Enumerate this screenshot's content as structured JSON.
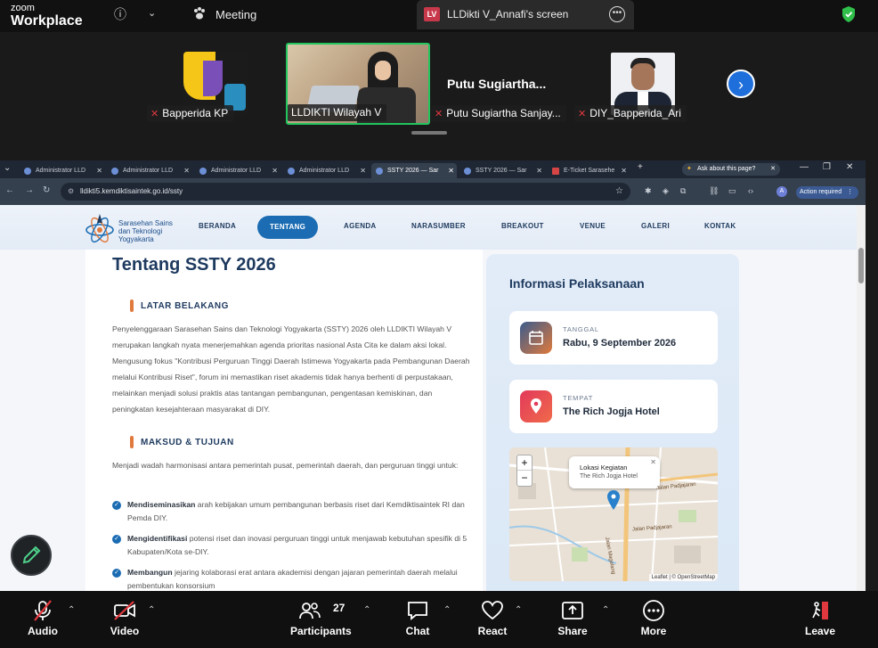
{
  "zoom": {
    "brand_small": "zoom",
    "brand_big": "Workplace",
    "meeting_label": "Meeting",
    "share_badge": "LV",
    "share_label": "LLDikti V_Annafi's screen"
  },
  "participants": [
    {
      "name": "Bapperida KP"
    },
    {
      "name": "LLDIKTI Wilayah V"
    },
    {
      "name": "Putu Sugiartha Sanjay...",
      "title": "Putu  Sugiartha..."
    },
    {
      "name": "DIY_Bapperida_Ari"
    }
  ],
  "browser": {
    "tabs": [
      {
        "label": "Administrator LLD"
      },
      {
        "label": "Administrator LLD"
      },
      {
        "label": "Administrator LLD"
      },
      {
        "label": "Administrator LLD"
      },
      {
        "label": "SSTY 2026 — Sar"
      },
      {
        "label": "SSTY 2026 — Sar"
      },
      {
        "label": "E-Ticket Sarasehe"
      }
    ],
    "ask_label": "Ask about this page?",
    "url": "lldikti5.kemdiktisaintek.go.id/ssty",
    "action_required": "Action required"
  },
  "site": {
    "brand_line1": "Sarasehan Sains",
    "brand_line2": "dan Teknologi",
    "brand_line3": "Yogyakarta",
    "nav": [
      "BERANDA",
      "TENTANG",
      "AGENDA",
      "NARASUMBER",
      "BREAKOUT",
      "VENUE",
      "GALERI",
      "KONTAK"
    ],
    "page_title": "Tentang SSTY 2026",
    "section1_head": "LATAR BELAKANG",
    "section1_text": "Penyelenggaraan Sarasehan Sains dan Teknologi Yogyakarta (SSTY) 2026 oleh LLDIKTI Wilayah V merupakan langkah nyata menerjemahkan agenda prioritas nasional Asta Cita ke dalam aksi lokal. Mengusung fokus \"Kontribusi Perguruan Tinggi Daerah Istimewa Yogyakarta pada Pembangunan Daerah melalui Kontribusi Riset\", forum ini memastikan riset akademis tidak hanya berhenti di perpustakaan, melainkan menjadi solusi praktis atas tantangan pembangunan, pengentasan kemiskinan, dan peningkatan kesejahteraan masyarakat di DIY.",
    "section2_head": "MAKSUD & TUJUAN",
    "section2_intro": "Menjadi wadah harmonisasi antara pemerintah pusat, pemerintah daerah, dan perguruan tinggi untuk:",
    "bullets": [
      {
        "bold": "Mendiseminasikan",
        "text": " arah kebijakan umum pembangunan berbasis riset dari Kemdiktisaintek RI dan Pemda DIY."
      },
      {
        "bold": "Mengidentifikasi",
        "text": " potensi riset dan inovasi perguruan tinggi untuk menjawab kebutuhan spesifik di 5 Kabupaten/Kota se-DIY."
      },
      {
        "bold": "Membangun",
        "text": " jejaring kolaborasi erat antara akademisi dengan jajaran pemerintah daerah melalui pembentukan konsorsium"
      }
    ],
    "info_title": "Informasi Pelaksanaan",
    "date_label": "TANGGAL",
    "date_value": "Rabu, 9 September 2026",
    "place_label": "TEMPAT",
    "place_value": "The Rich Jogja Hotel",
    "map_popup_title": "Lokasi Kegiatan",
    "map_popup_sub": "The Rich Jogja Hotel",
    "map_attrib": "Leaflet | © OpenStreetMap",
    "map_zoom_in": "+",
    "map_zoom_out": "−",
    "map_street1": "Jalan Padjajaran",
    "map_street2": "Jalan Magelang",
    "map_street3": "Jalan Padjajaran"
  },
  "toolbar": {
    "audio": "Audio",
    "video": "Video",
    "participants": "Participants",
    "participants_count": "27",
    "chat": "Chat",
    "react": "React",
    "share": "Share",
    "more": "More",
    "leave": "Leave"
  },
  "colors": {
    "accent": "#1b6cb3",
    "leave": "#e0383e",
    "speaker_border": "#22c55e"
  }
}
